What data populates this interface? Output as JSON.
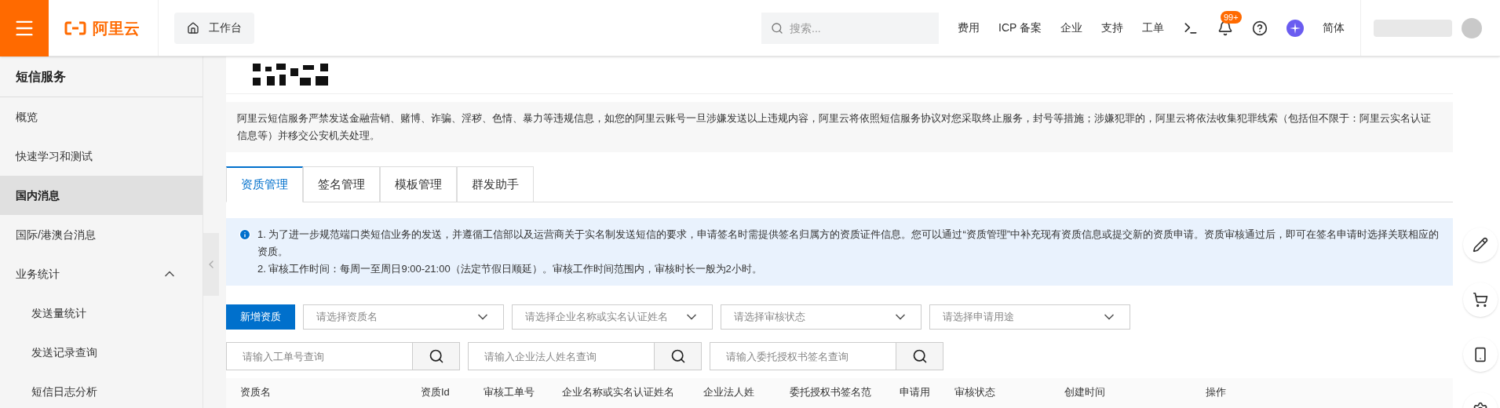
{
  "topbar": {
    "logo": "阿里云",
    "workbench": "工作台",
    "search": {
      "placeholder": "搜索..."
    },
    "nav": [
      {
        "kind": "text",
        "label": "费用"
      },
      {
        "kind": "text",
        "label": "ICP 备案"
      },
      {
        "kind": "text",
        "label": "企业"
      },
      {
        "kind": "text",
        "label": "支持"
      },
      {
        "kind": "text",
        "label": "工单"
      },
      {
        "kind": "terminal"
      },
      {
        "kind": "bell",
        "badge": "99+"
      },
      {
        "kind": "help"
      },
      {
        "kind": "star"
      },
      {
        "kind": "text",
        "label": "简体"
      }
    ]
  },
  "sidebar": {
    "title": "短信服务",
    "items": [
      {
        "label": "概览",
        "selected": false
      },
      {
        "label": "快速学习和测试",
        "selected": false
      },
      {
        "label": "国内消息",
        "selected": true
      },
      {
        "label": "国际/港澳台消息",
        "selected": false
      },
      {
        "label": "业务统计",
        "selected": false,
        "expanded": true,
        "children": [
          {
            "label": "发送量统计",
            "selected": false
          },
          {
            "label": "发送记录查询",
            "selected": false
          },
          {
            "label": "短信日志分析",
            "selected": false
          }
        ]
      }
    ]
  },
  "notice": "阿里云短信服务严禁发送金融营销、赌博、诈骗、淫秽、色情、暴力等违规信息，如您的阿里云账号一旦涉嫌发送以上违规内容，阿里云将依照短信服务协议对您采取终止服务，封号等措施；涉嫌犯罪的，阿里云将依法收集犯罪线索（包括但不限于：阿里云实名认证信息等）并移交公安机关处理。",
  "tabs": [
    {
      "label": "资质管理",
      "selected": true
    },
    {
      "label": "签名管理",
      "selected": false
    },
    {
      "label": "模板管理",
      "selected": false
    },
    {
      "label": "群发助手",
      "selected": false
    }
  ],
  "info": [
    "1. 为了进一步规范端口类短信业务的发送，并遵循工信部以及运营商关于实名制发送短信的要求，申请签名时需提供签名归属方的资质证件信息。您可以通过“资质管理”中补充现有资质信息或提交新的资质申请。资质审核通过后，即可在签名申请时选择关联相应的资质。",
    "2. 审核工作时间：每周一至周日9:00-21:00（法定节假日顺延）。审核工作时间范围内，审核时长一般为2小时。"
  ],
  "add_button": "新增资质",
  "selects": [
    {
      "placeholder": "请选择资质名"
    },
    {
      "placeholder": "请选择企业名称或实名认证姓名"
    },
    {
      "placeholder": "请选择审核状态"
    },
    {
      "placeholder": "请选择申请用途"
    }
  ],
  "searches": [
    {
      "placeholder": "请输入工单号查询"
    },
    {
      "placeholder": "请输入企业法人姓名查询"
    },
    {
      "placeholder": "请输入委托授权书签名查询"
    }
  ],
  "table": {
    "columns": [
      "资质名",
      "资质Id",
      "审核工单号",
      "企业名称或实名认证姓名",
      "企业法人姓",
      "委托授权书签名范",
      "申请用",
      "审核状态",
      "创建时间",
      "操作"
    ]
  }
}
